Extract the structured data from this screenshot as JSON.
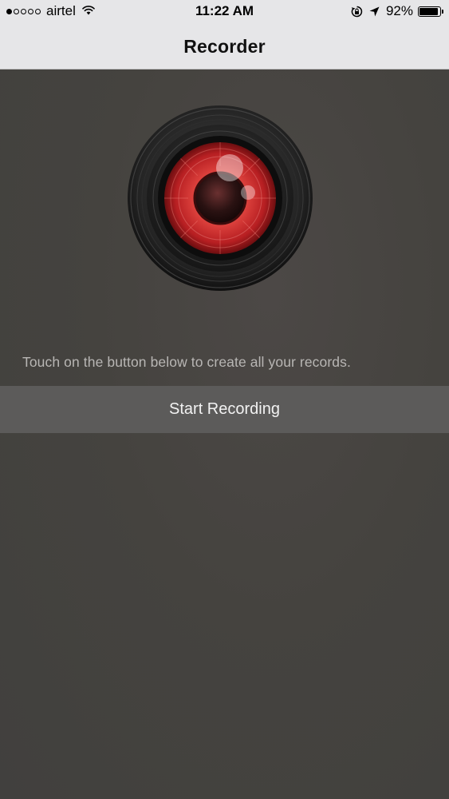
{
  "status_bar": {
    "carrier": "airtel",
    "time": "11:22 AM",
    "battery_percent": "92%",
    "battery_level": 0.92,
    "signal_bars_filled": 1,
    "signal_bars_total": 5,
    "icons": [
      "wifi-icon",
      "rotation-lock-icon",
      "location-arrow-icon",
      "battery-icon"
    ]
  },
  "nav": {
    "title": "Recorder"
  },
  "main": {
    "hint_text": "Touch on the button below to create all your records.",
    "start_button_label": "Start Recording",
    "hero_icon": "camera-lens-icon"
  },
  "colors": {
    "bar_bg": "#e6e6e8",
    "content_bg": "#444240",
    "button_bg": "#5c5b5a",
    "lens_red": "#d9363a"
  }
}
